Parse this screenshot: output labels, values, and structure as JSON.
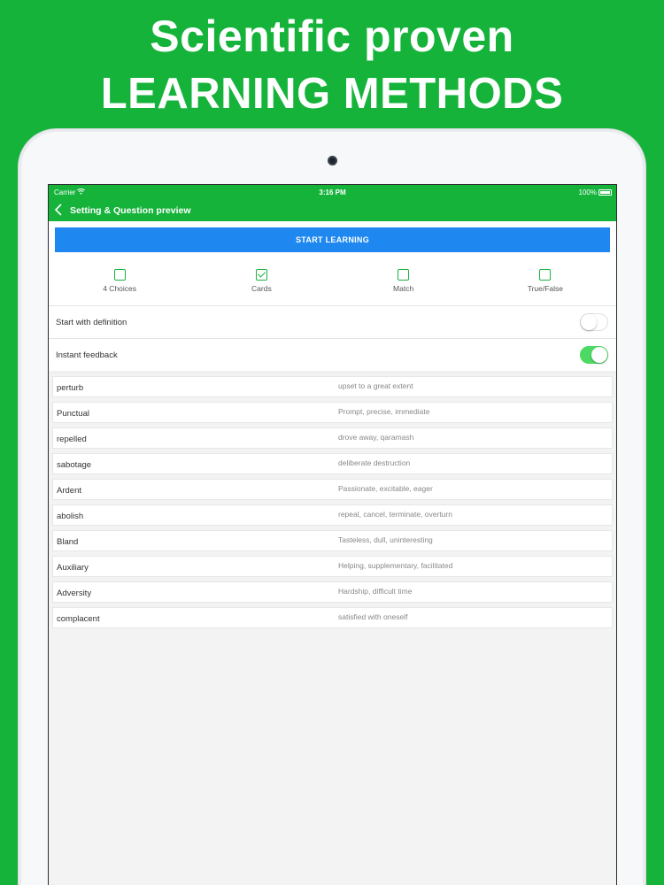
{
  "promo": {
    "line1": "Scientific proven",
    "line2": "LEARNING METHODS",
    "background": "#16b33b"
  },
  "status_bar": {
    "carrier": "Carrier",
    "wifi_icon": "wifi-icon",
    "time": "3:16 PM",
    "battery": "100%"
  },
  "nav": {
    "back_icon": "chevron-left-icon",
    "title": "Setting & Question preview"
  },
  "start_button": "START LEARNING",
  "modes": [
    {
      "label": "4 Choices",
      "checked": false
    },
    {
      "label": "Cards",
      "checked": true
    },
    {
      "label": "Match",
      "checked": false
    },
    {
      "label": "True/False",
      "checked": false
    }
  ],
  "settings": [
    {
      "label": "Start with definition",
      "on": false
    },
    {
      "label": "Instant feedback",
      "on": true
    }
  ],
  "words": [
    {
      "term": "perturb",
      "definition": "upset to a great extent"
    },
    {
      "term": "Punctual",
      "definition": "Prompt, precise, immediate"
    },
    {
      "term": "repelled",
      "definition": "drove away, qaramash"
    },
    {
      "term": "sabotage",
      "definition": "deliberate destruction"
    },
    {
      "term": "Ardent",
      "definition": "Passionate, excitable, eager"
    },
    {
      "term": "abolish",
      "definition": "repeal, cancel, terminate, overturn"
    },
    {
      "term": "Bland",
      "definition": "Tasteless, dull, uninteresting"
    },
    {
      "term": "Auxiliary",
      "definition": "Helping, supplementary, facilitated"
    },
    {
      "term": "Adversity",
      "definition": "Hardship, difficult time"
    },
    {
      "term": "complacent",
      "definition": "satisfied with oneself"
    }
  ],
  "colors": {
    "accent_green": "#16b33b",
    "button_blue": "#1e88f0",
    "toggle_on": "#4cd964"
  }
}
